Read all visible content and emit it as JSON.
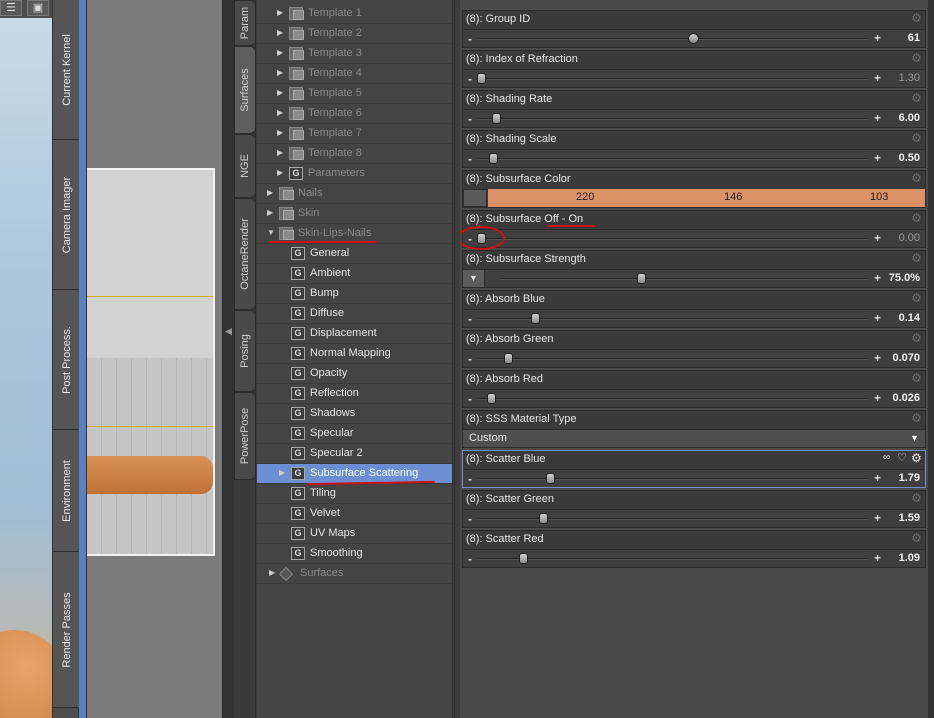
{
  "viewport_toolbar": {
    "list_icon_glyph": "☰",
    "camera_icon_glyph": "▣"
  },
  "side_tabs": [
    "Current Kernel",
    "Camera Imager",
    "Post Process.",
    "Environment",
    "Render Passes"
  ],
  "pane_tabs": [
    "Param",
    "Surfaces",
    "NGE",
    "OctaneRender",
    "Posing",
    "PowerPose"
  ],
  "tree": {
    "templates": [
      "Template 1",
      "Template 2",
      "Template 3",
      "Template 4",
      "Template 5",
      "Template 6",
      "Template 7",
      "Template 8"
    ],
    "parameters": "Parameters",
    "nails": "Nails",
    "skin": "Skin",
    "group": "Skin-Lips-Nails",
    "shaders": [
      "General",
      "Ambient",
      "Bump",
      "Diffuse",
      "Displacement",
      "Normal Mapping",
      "Opacity",
      "Reflection",
      "Shadows",
      "Specular",
      "Specular 2",
      "Subsurface Scattering",
      "Tiling",
      "Velvet",
      "UV Maps",
      "Smoothing"
    ],
    "selected": "Subsurface Scattering",
    "surfaces": "Surfaces",
    "shader_icon_letter": "G"
  },
  "properties": [
    {
      "title": "(8): Group ID",
      "type": "slider",
      "value": "61",
      "level": 0.55,
      "round_thumb": true
    },
    {
      "title": "(8): Index of Refraction",
      "type": "slider",
      "value": "1.30",
      "level": 0.0,
      "dim_value": true
    },
    {
      "title": "(8): Shading Rate",
      "type": "slider",
      "value": "6.00",
      "level": 0.04
    },
    {
      "title": "(8): Shading Scale",
      "type": "slider",
      "value": "0.50",
      "level": 0.03
    },
    {
      "title": "(8): Subsurface Color",
      "type": "color",
      "r": "220",
      "g": "146",
      "b": "103",
      "color": "#dc9267"
    },
    {
      "title": "(8): Subsurface Off - On",
      "type": "slider",
      "value": "0.00",
      "level": 0.0,
      "dim_value": true
    },
    {
      "title": "(8): Subsurface Strength",
      "type": "slider_drop",
      "value": "75.0%",
      "level": 0.38
    },
    {
      "title": "(8): Absorb Blue",
      "type": "slider",
      "value": "0.14",
      "level": 0.14
    },
    {
      "title": "(8): Absorb Green",
      "type": "slider",
      "value": "0.070",
      "level": 0.07
    },
    {
      "title": "(8): Absorb Red",
      "type": "slider",
      "value": "0.026",
      "level": 0.026
    },
    {
      "title": "(8): SSS Material Type",
      "type": "combo",
      "value": "Custom"
    },
    {
      "title": "(8): Scatter Blue",
      "type": "slider",
      "value": "1.79",
      "level": 0.18,
      "highlight": true
    },
    {
      "title": "(8): Scatter Green",
      "type": "slider",
      "value": "1.59",
      "level": 0.16
    },
    {
      "title": "(8): Scatter Red",
      "type": "slider",
      "value": "1.09",
      "level": 0.11
    }
  ],
  "glyphs": {
    "minus": "-",
    "plus": "+",
    "gear": "⚙",
    "link": "🔗",
    "heart": "♡",
    "drop_arrow": "▼",
    "tree_collapsed": "▶",
    "tree_expanded": "▼",
    "split_grip": "◀"
  },
  "colors": {
    "selection": "#6c8fd4",
    "annotation_red": "#cc1111",
    "highlight_border": "#6f8fcf"
  }
}
